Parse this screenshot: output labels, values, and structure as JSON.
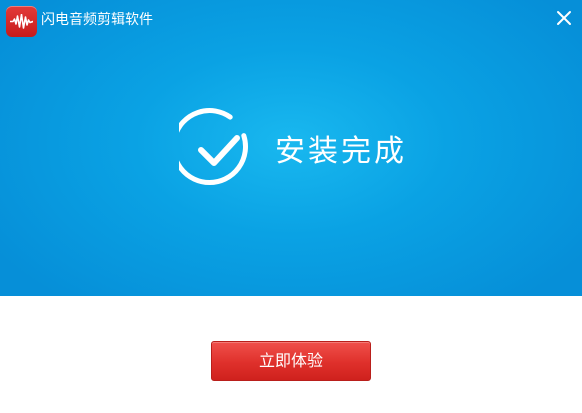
{
  "window": {
    "title": "闪电音频剪辑软件"
  },
  "titlebar": {
    "logo_icon": "audio-waveform-icon",
    "close_icon": "close-icon"
  },
  "banner": {
    "status_icon": "check-circle-icon",
    "status_text": "安装完成"
  },
  "actions": {
    "try_now_label": "立即体验"
  },
  "colors": {
    "banner_blue": "#0aa2e4",
    "button_red": "#df302b",
    "logo_red": "#d32a28"
  }
}
